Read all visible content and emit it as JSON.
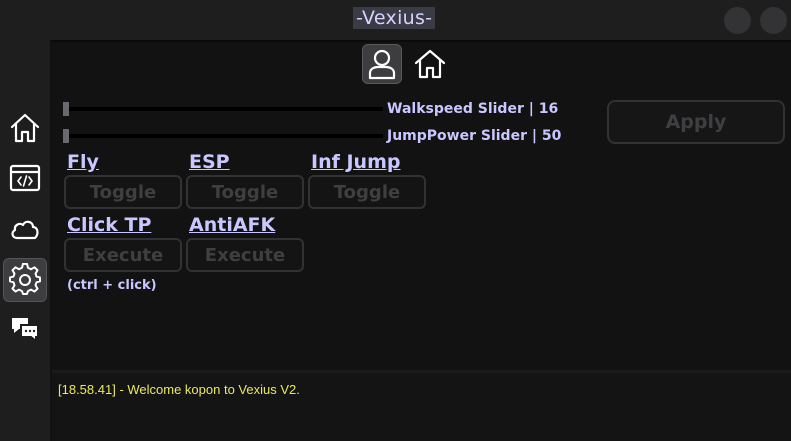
{
  "window": {
    "title": "-Vexius-",
    "controls": [
      "minimize-button",
      "close-button"
    ]
  },
  "sidebar": {
    "items": [
      {
        "id": "home",
        "icon": "home-icon",
        "active": false
      },
      {
        "id": "script-editor",
        "icon": "code-window-icon",
        "active": false
      },
      {
        "id": "cloud",
        "icon": "cloud-icon",
        "active": false
      },
      {
        "id": "settings",
        "icon": "gear-icon",
        "active": true
      },
      {
        "id": "chat",
        "icon": "chat-bubbles-icon",
        "active": false
      }
    ]
  },
  "tabs": [
    {
      "id": "player",
      "icon": "user-icon",
      "active": true
    },
    {
      "id": "home",
      "icon": "home-icon",
      "active": false
    }
  ],
  "sliders": {
    "walkspeed": {
      "label": "Walkspeed Slider | 16",
      "value": 16
    },
    "jumppower": {
      "label": "JumpPower Slider | 50",
      "value": 50
    }
  },
  "apply": {
    "label": "Apply"
  },
  "features": {
    "fly": {
      "label": "Fly",
      "button": "Toggle"
    },
    "esp": {
      "label": "ESP",
      "button": "Toggle"
    },
    "inf_jump": {
      "label": "Inf Jump",
      "button": "Toggle"
    },
    "click_tp": {
      "label": "Click TP",
      "button": "Execute"
    },
    "anti_afk": {
      "label": "AntiAFK",
      "button": "Execute"
    },
    "click_tp_hint": "(ctrl + click)"
  },
  "console": {
    "lines": [
      "[18.58.41] - Welcome kopon to Vexius V2."
    ]
  },
  "colors": {
    "accent": "#c9c7ff",
    "title_bg": "#3b3b46",
    "console_text": "#ece85a",
    "panel_bg": "#121213",
    "disabled_text": "#3f3f42"
  }
}
